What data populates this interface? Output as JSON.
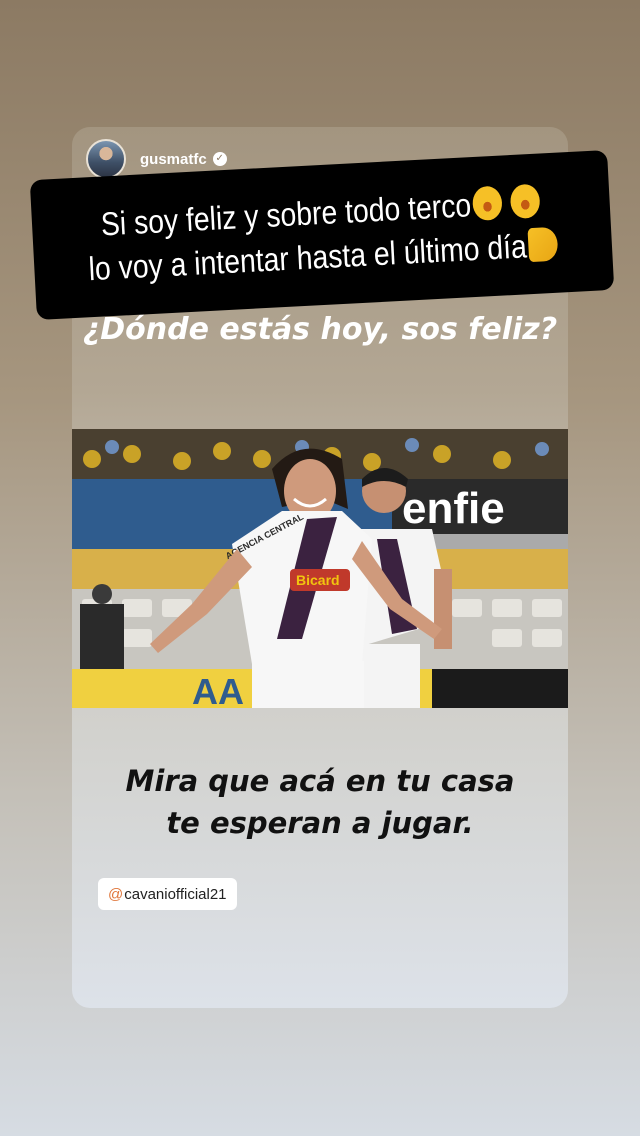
{
  "story": {
    "username": "gusmatfc",
    "caption": {
      "line1": "Si soy feliz y sobre todo terco",
      "line2": "lo voy a intentar hasta el último día"
    },
    "question": "¿Dónde estás hoy, sos feliz?",
    "photo": {
      "jersey_text": "AGENCIA CENTRAL",
      "jersey_logo": "Bicard",
      "stadium_sign": "enfie",
      "banner_text": "AA"
    },
    "closing": {
      "line1": "Mira que acá en tu casa",
      "line2": "te esperan a jugar."
    },
    "mention": "cavaniofficial21"
  },
  "colors": {
    "background_top": "#8c7a63",
    "background_bottom": "#d6dce3",
    "mention_accent": "#e0763b"
  }
}
